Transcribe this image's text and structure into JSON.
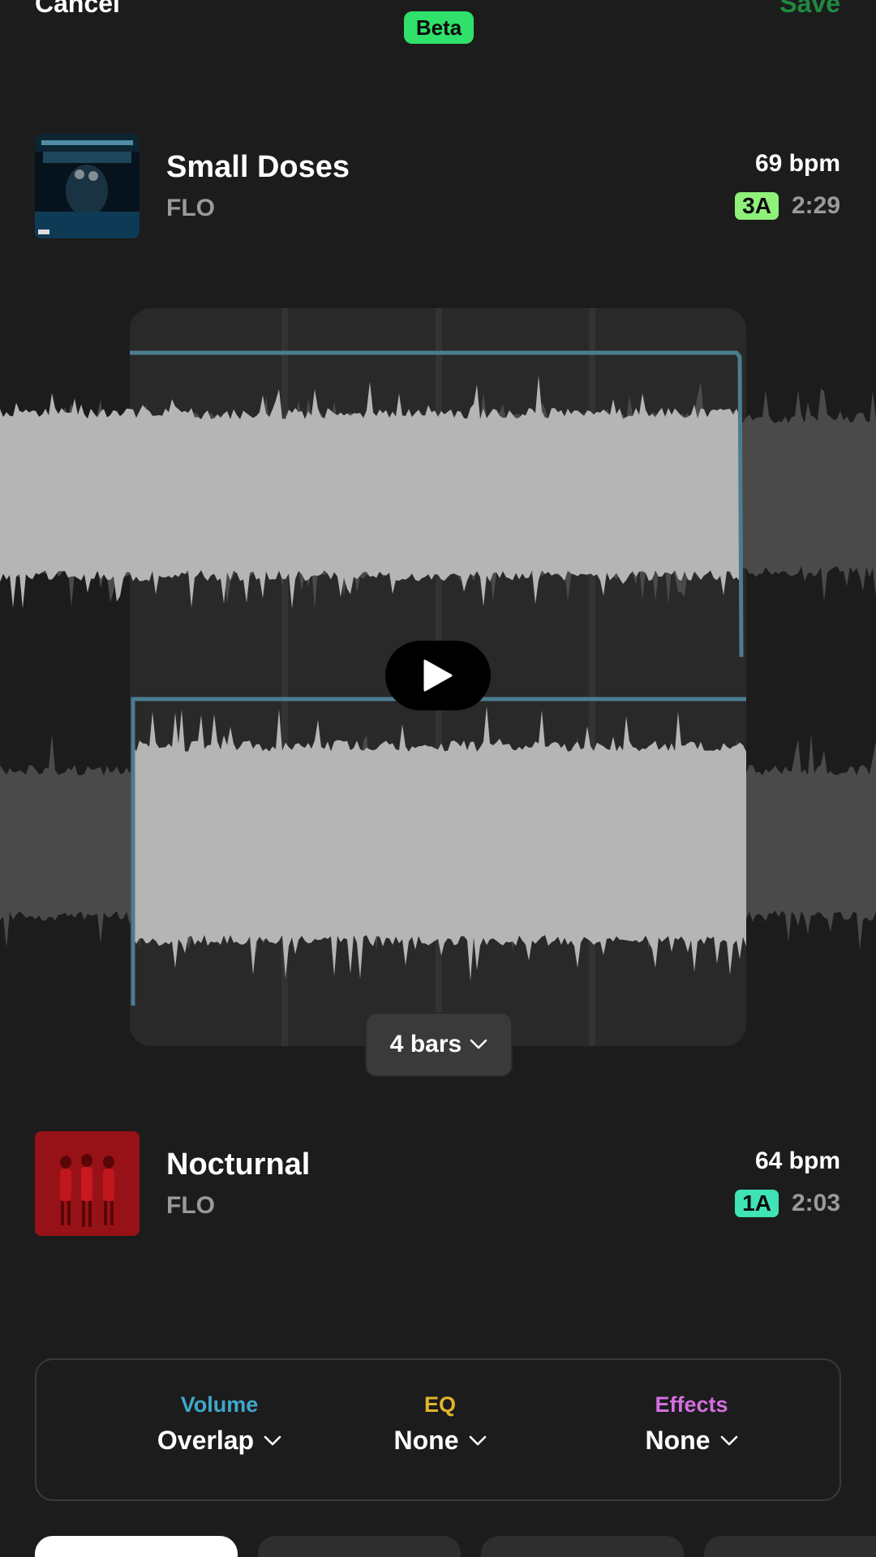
{
  "header": {
    "cancel_label": "Cancel",
    "badge": "Beta",
    "save_label": "Save"
  },
  "track_top": {
    "title": "Small Doses",
    "artist": "FLO",
    "bpm": "69 bpm",
    "key": "3A",
    "key_color": "#8ff07a",
    "duration": "2:29"
  },
  "transition": {
    "bars_label": "4 bars",
    "accent_color": "#4b7d90"
  },
  "track_bottom": {
    "title": "Nocturnal",
    "artist": "FLO",
    "bpm": "64 bpm",
    "key": "1A",
    "key_color": "#3fe3b5",
    "duration": "2:03"
  },
  "controls": {
    "volume": {
      "label": "Volume",
      "value": "Overlap",
      "color": "#3fa9c9"
    },
    "eq": {
      "label": "EQ",
      "value": "None",
      "color": "#e3b529"
    },
    "effects": {
      "label": "Effects",
      "value": "None",
      "color": "#d46fe0"
    }
  },
  "icons": {
    "play": "play-icon",
    "chevron": "chevron-down-icon"
  }
}
